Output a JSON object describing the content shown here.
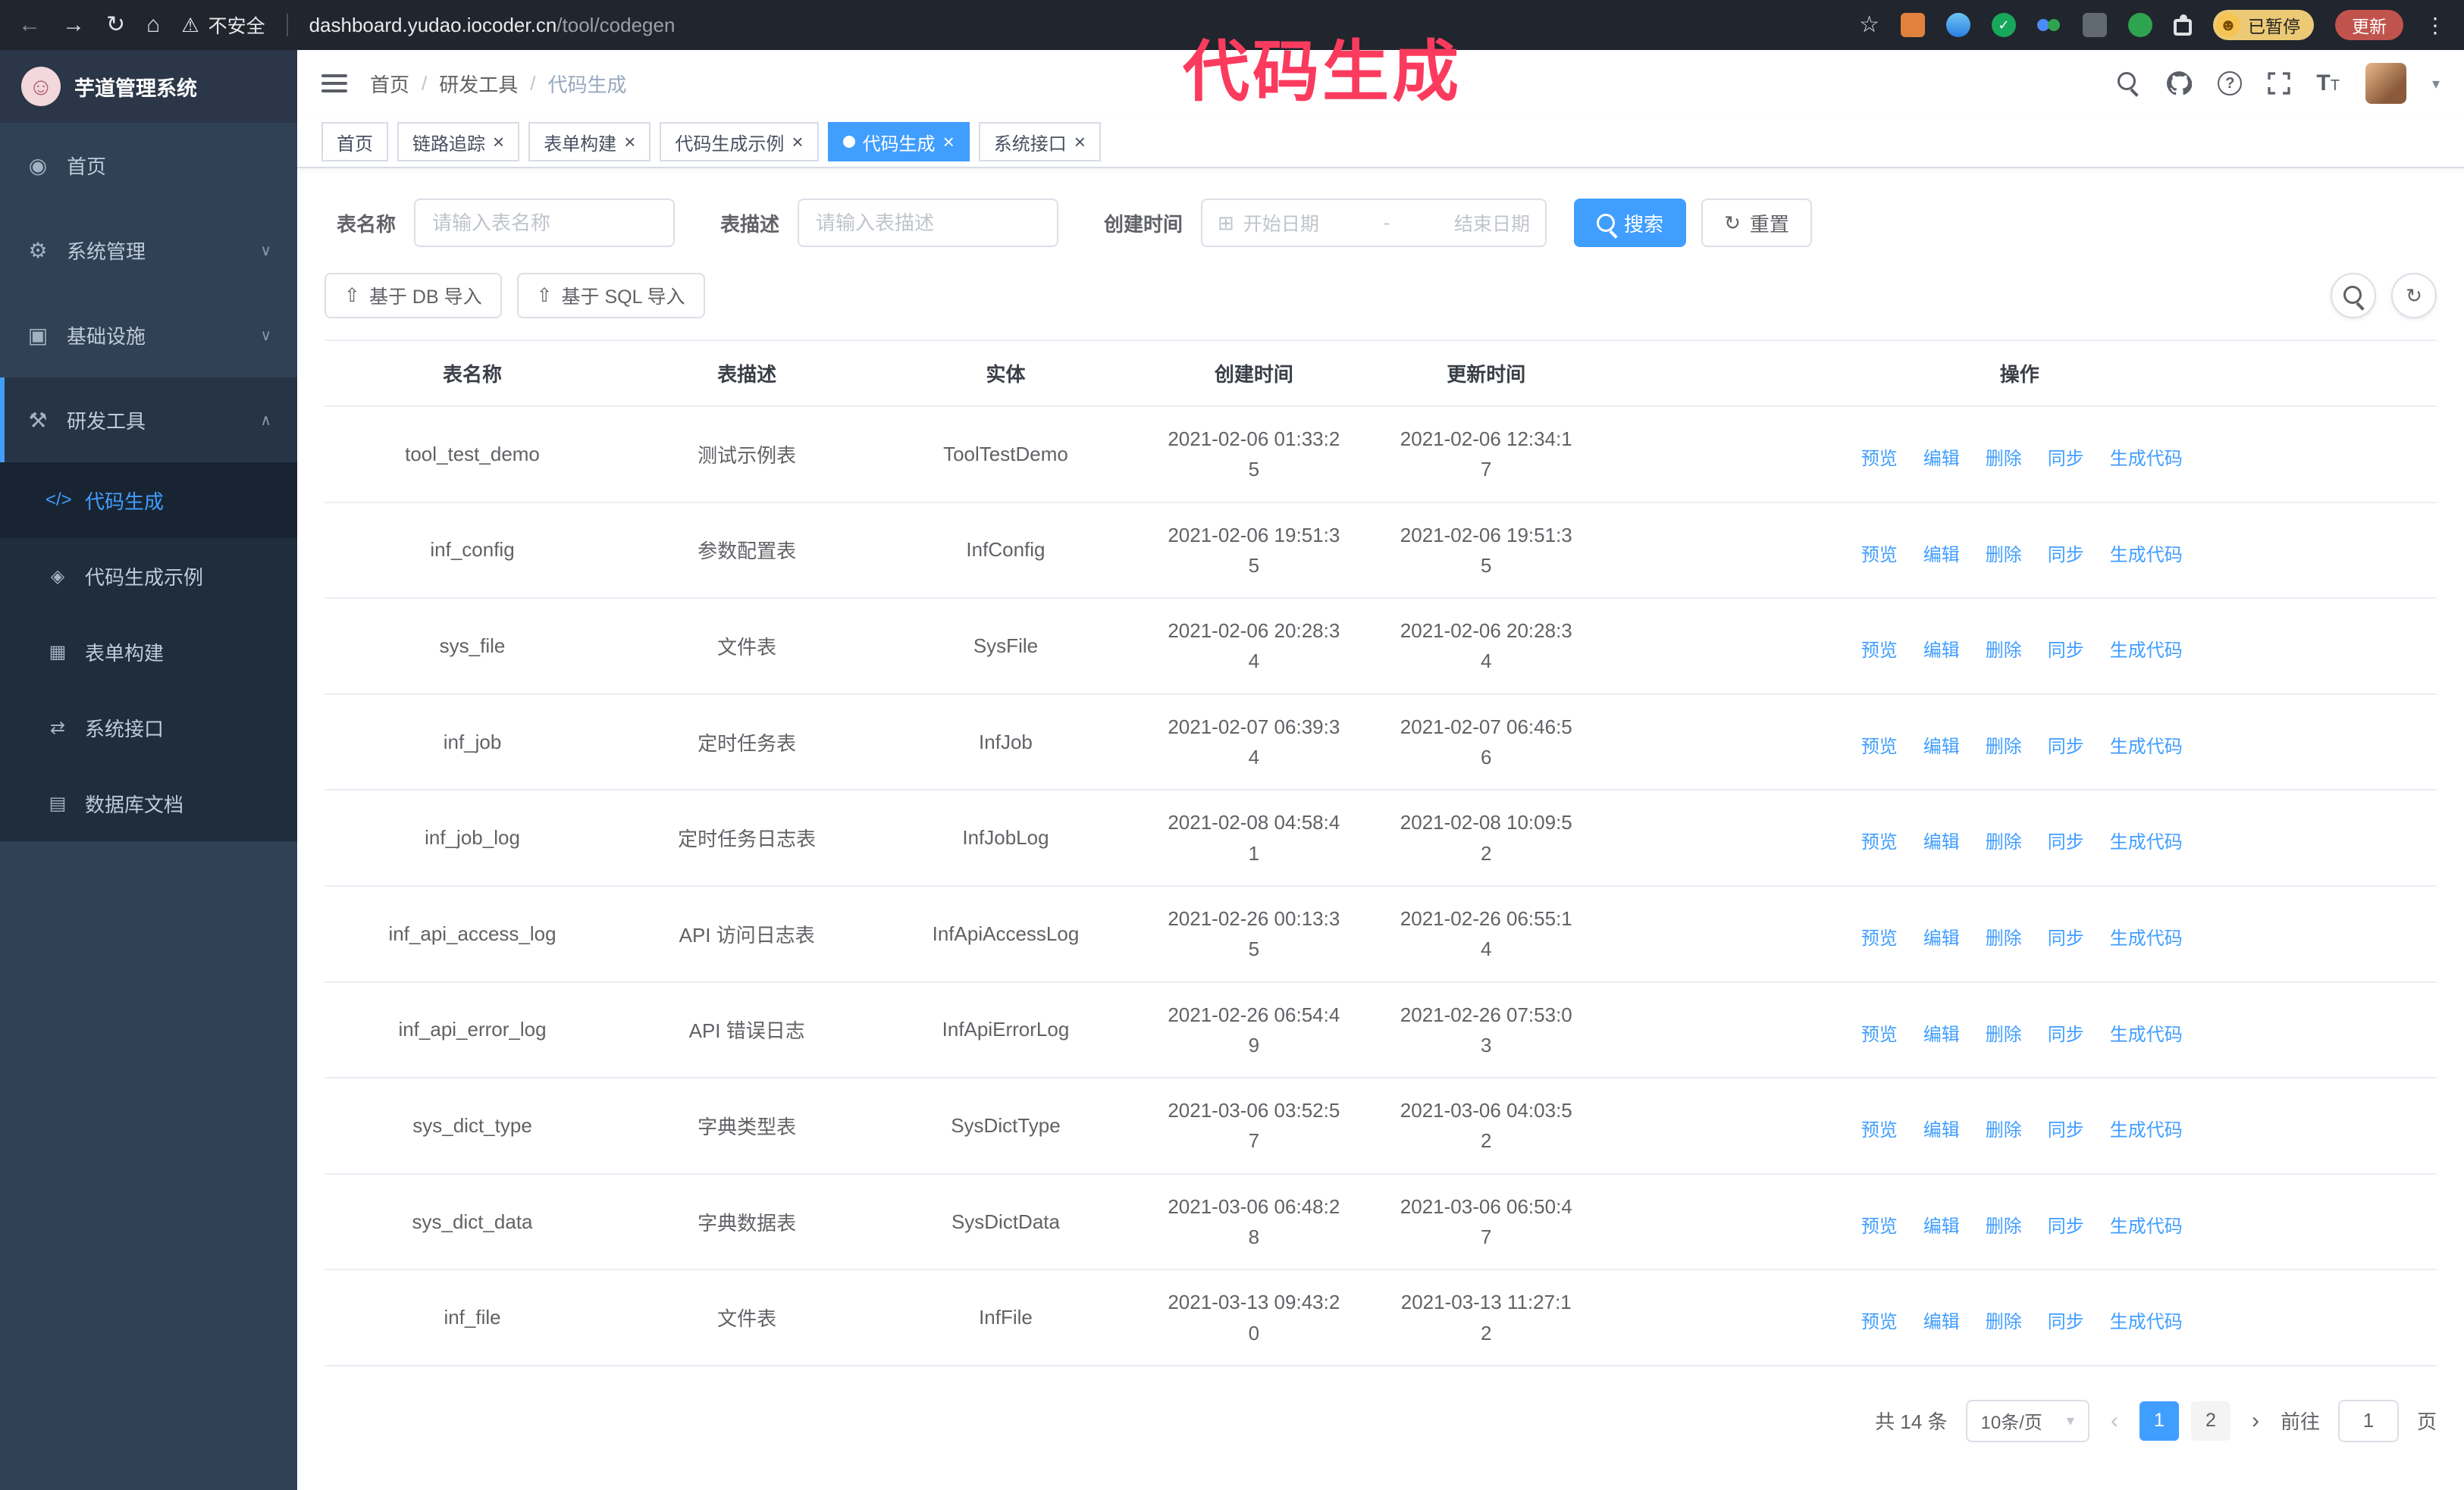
{
  "browser": {
    "security_label": "不安全",
    "url_host": "dashboard.yudao.iocoder.cn",
    "url_path": "/tool/codegen",
    "paused_badge": "已暂停",
    "update_button": "更新"
  },
  "annotation": {
    "text": "代码生成"
  },
  "sidebar": {
    "logo_title": "芋道管理系统",
    "menu": [
      {
        "label": "首页"
      },
      {
        "label": "系统管理"
      },
      {
        "label": "基础设施"
      },
      {
        "label": "研发工具"
      }
    ],
    "submenu": [
      {
        "label": "代码生成"
      },
      {
        "label": "代码生成示例"
      },
      {
        "label": "表单构建"
      },
      {
        "label": "系统接口"
      },
      {
        "label": "数据库文档"
      }
    ]
  },
  "header": {
    "breadcrumb": [
      "首页",
      "研发工具",
      "代码生成"
    ],
    "separator": "/"
  },
  "tabs": [
    {
      "label": "首页"
    },
    {
      "label": "链路追踪"
    },
    {
      "label": "表单构建"
    },
    {
      "label": "代码生成示例"
    },
    {
      "label": "代码生成"
    },
    {
      "label": "系统接口"
    }
  ],
  "filters": {
    "table_name_label": "表名称",
    "table_name_placeholder": "请输入表名称",
    "table_desc_label": "表描述",
    "table_desc_placeholder": "请输入表描述",
    "create_time_label": "创建时间",
    "date_start_placeholder": "开始日期",
    "date_separator": "-",
    "date_end_placeholder": "结束日期",
    "search_button": "搜索",
    "reset_button": "重置"
  },
  "toolbar": {
    "import_db": "基于 DB 导入",
    "import_sql": "基于 SQL 导入"
  },
  "table": {
    "columns": [
      "表名称",
      "表描述",
      "实体",
      "创建时间",
      "更新时间",
      "操作"
    ],
    "actions": [
      "预览",
      "编辑",
      "删除",
      "同步",
      "生成代码"
    ],
    "rows": [
      {
        "name": "tool_test_demo",
        "desc": "测试示例表",
        "entity": "ToolTestDemo",
        "created": "2021-02-06 01:33:25",
        "updated": "2021-02-06 12:34:17"
      },
      {
        "name": "inf_config",
        "desc": "参数配置表",
        "entity": "InfConfig",
        "created": "2021-02-06 19:51:35",
        "updated": "2021-02-06 19:51:35"
      },
      {
        "name": "sys_file",
        "desc": "文件表",
        "entity": "SysFile",
        "created": "2021-02-06 20:28:34",
        "updated": "2021-02-06 20:28:34"
      },
      {
        "name": "inf_job",
        "desc": "定时任务表",
        "entity": "InfJob",
        "created": "2021-02-07 06:39:34",
        "updated": "2021-02-07 06:46:56"
      },
      {
        "name": "inf_job_log",
        "desc": "定时任务日志表",
        "entity": "InfJobLog",
        "created": "2021-02-08 04:58:41",
        "updated": "2021-02-08 10:09:52"
      },
      {
        "name": "inf_api_access_log",
        "desc": "API 访问日志表",
        "entity": "InfApiAccessLog",
        "created": "2021-02-26 00:13:35",
        "updated": "2021-02-26 06:55:14"
      },
      {
        "name": "inf_api_error_log",
        "desc": "API 错误日志",
        "entity": "InfApiErrorLog",
        "created": "2021-02-26 06:54:49",
        "updated": "2021-02-26 07:53:03"
      },
      {
        "name": "sys_dict_type",
        "desc": "字典类型表",
        "entity": "SysDictType",
        "created": "2021-03-06 03:52:57",
        "updated": "2021-03-06 04:03:52"
      },
      {
        "name": "sys_dict_data",
        "desc": "字典数据表",
        "entity": "SysDictData",
        "created": "2021-03-06 06:48:28",
        "updated": "2021-03-06 06:50:47"
      },
      {
        "name": "inf_file",
        "desc": "文件表",
        "entity": "InfFile",
        "created": "2021-03-13 09:43:20",
        "updated": "2021-03-13 11:27:12"
      }
    ]
  },
  "pagination": {
    "total": "共 14 条",
    "page_size": "10条/页",
    "pages": [
      "1",
      "2"
    ],
    "active_page": "1",
    "goto_label": "前往",
    "goto_value": "1",
    "goto_unit": "页"
  },
  "icons": {
    "back": "←",
    "forward": "→",
    "reload": "↻",
    "home": "⌂",
    "warning": "⚠",
    "star": "☆",
    "more": "⋮",
    "check": "✓",
    "face": "☻",
    "logo_face": "☺",
    "help": "?",
    "caret_down": "▾",
    "chevron_down": "∨",
    "chevron_up": "∧",
    "dashboard": "◉",
    "settings": "⚙",
    "infra": "▣",
    "tools": "⚒",
    "code": "</>",
    "example": "◈",
    "form": "▦",
    "api": "⇄",
    "database": "▤",
    "close": "×",
    "calendar": "⊞",
    "upload": "⇧",
    "refresh": "↻",
    "prev": "‹",
    "next": "›",
    "font_large": "T",
    "font_small": "T"
  }
}
